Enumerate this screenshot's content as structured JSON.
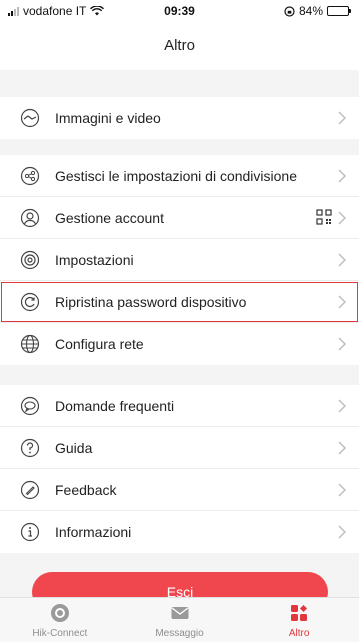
{
  "status_bar": {
    "carrier": "vodafone IT",
    "time": "09:39",
    "battery_percent": "84%",
    "battery_level": 0.84
  },
  "nav": {
    "title": "Altro"
  },
  "groups": [
    [
      {
        "label": "Immagini e video",
        "icon": "play-circle-icon"
      }
    ],
    [
      {
        "label": "Gestisci le impostazioni di condivisione",
        "icon": "share-icon"
      },
      {
        "label": "Gestione account",
        "icon": "user-icon"
      },
      {
        "label": "Impostazioni",
        "icon": "settings-icon"
      },
      {
        "label": "Ripristina password dispositivo",
        "icon": "reset-password-icon",
        "highlighted": true
      },
      {
        "label": "Configura rete",
        "icon": "globe-icon"
      }
    ],
    [
      {
        "label": "Domande frequenti",
        "icon": "chat-bubble-icon"
      },
      {
        "label": "Guida",
        "icon": "question-icon"
      },
      {
        "label": "Feedback",
        "icon": "pencil-icon"
      },
      {
        "label": "Informazioni",
        "icon": "info-icon"
      }
    ]
  ],
  "logout_label": "Esci",
  "tabs": [
    {
      "label": "Hik-Connect",
      "icon": "camera-lens-icon",
      "active": false
    },
    {
      "label": "Messaggio",
      "icon": "envelope-icon",
      "active": false
    },
    {
      "label": "Altro",
      "icon": "grid-icon",
      "active": true
    }
  ],
  "colors": {
    "accent": "#e3373f",
    "button": "#f0474f",
    "background": "#f4f4f4"
  }
}
